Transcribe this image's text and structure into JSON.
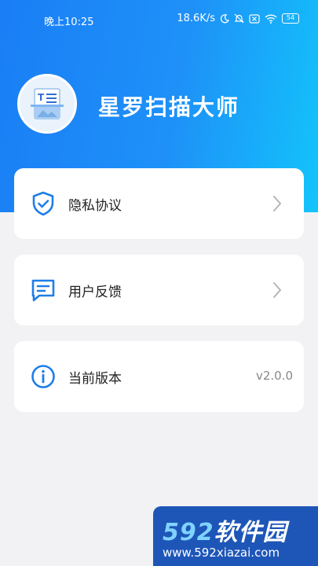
{
  "status": {
    "time": "晚上10:25",
    "net_speed": "18.6K/s",
    "battery": "54"
  },
  "app": {
    "name": "星罗扫描大师"
  },
  "menu": [
    {
      "label": "隐私协议",
      "icon": "shield-check-icon",
      "trailing": "chevron"
    },
    {
      "label": "用户反馈",
      "icon": "message-icon",
      "trailing": "chevron"
    },
    {
      "label": "当前版本",
      "icon": "info-icon",
      "trailing": "v2.0.0"
    }
  ],
  "watermark": {
    "brand_num": "592",
    "brand_text": "软件园",
    "url": "www.592xiazai.com"
  },
  "colors": {
    "accent": "#1a7ef6",
    "icon_blue": "#1f7ee8"
  }
}
